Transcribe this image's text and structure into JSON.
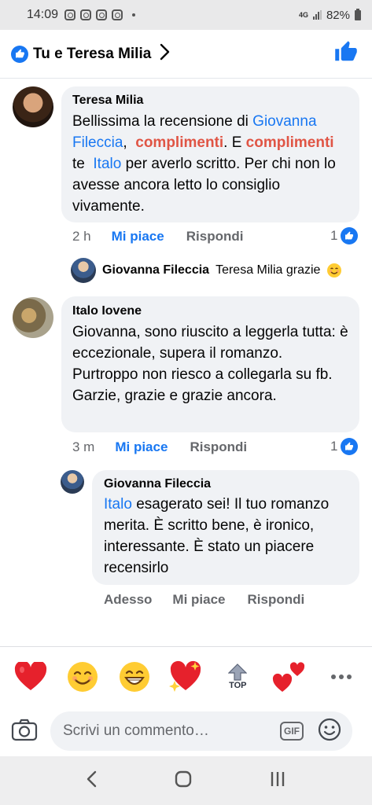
{
  "status_bar": {
    "time": "14:09",
    "network": "4G",
    "battery": "82%"
  },
  "header": {
    "title": "Tu e Teresa Milia"
  },
  "comments": [
    {
      "author": "Teresa Milia",
      "text": {
        "p1": "Bellissima la recensione di ",
        "tag1a": "Giovanna",
        "tag1b": "Fileccia",
        "p2": ",  ",
        "h1": "complimenti",
        "p3": ". E ",
        "h2": "complimenti",
        "p4": "te  ",
        "tag2": "Italo",
        "p5": " per averlo scritto. Per chi non lo avesse ancora letto lo consiglio vivamente."
      },
      "time": "2 h",
      "like_label": "Mi piace",
      "reply_label": "Rispondi",
      "reaction_count": "1"
    },
    {
      "author": "Italo Iovene",
      "text": "Giovanna, sono riuscito a leggerla tutta: è eccezionale, supera il romanzo. Purtroppo non riesco a collegarla su fb. Garzie, grazie e grazie ancora.",
      "time": "3 m",
      "like_label": "Mi piace",
      "reply_label": "Rispondi",
      "reaction_count": "1"
    }
  ],
  "collapsed_reply": {
    "author": "Giovanna Fileccia",
    "text": "Teresa Milia grazie",
    "emoji": "smiling-face"
  },
  "reply": {
    "author": "Giovanna Fileccia",
    "tag": "Italo",
    "text": " esagerato sei! Il tuo romanzo merita. È scritto bene, è ironico, interessante. È stato un piacere recensirlo",
    "time": "Adesso",
    "like_label": "Mi piace",
    "reply_label": "Rispondi"
  },
  "reaction_bar": {
    "items": [
      "red-heart",
      "smiling-face",
      "grinning-face",
      "sparkling-heart",
      "top-arrow",
      "two-hearts"
    ],
    "top_label": "TOP"
  },
  "composer": {
    "placeholder": "Scrivi un commento…",
    "gif_label": "GIF"
  },
  "colors": {
    "accent": "#1877f2",
    "highlight": "#e05545",
    "bubble": "#f0f2f5",
    "secondary_text": "#65676b"
  }
}
